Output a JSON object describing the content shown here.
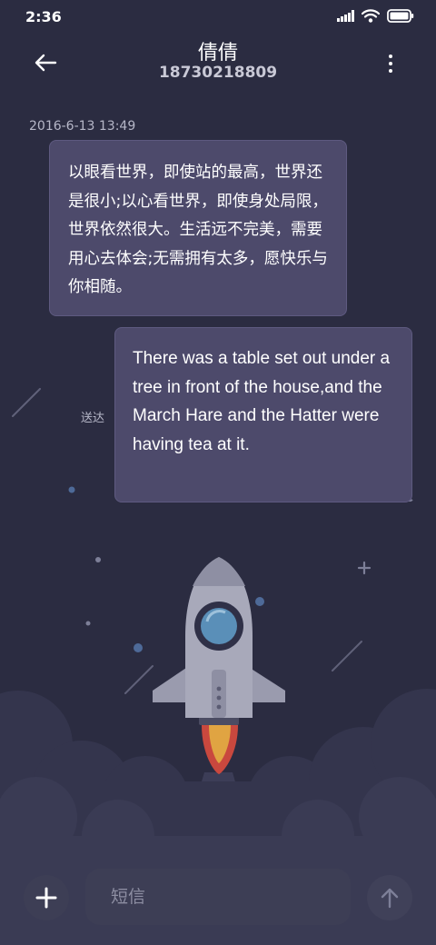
{
  "status_bar": {
    "time": "2:36",
    "icons": [
      "signal-icon",
      "wifi-icon",
      "battery-icon"
    ]
  },
  "header": {
    "back_icon": "back-arrow-icon",
    "contact_name": "倩倩",
    "contact_number": "18730218809",
    "more_icon": "more-vertical-icon"
  },
  "messages": [
    {
      "timestamp": "2016-6-13 13:49",
      "direction": "incoming",
      "text": "以眼看世界，即使站的最高，世界还是很小;以心看世界，即使身处局限，世界依然很大。生活远不完美，需要用心去体会;无需拥有太多，愿快乐与你相随。"
    },
    {
      "direction": "outgoing",
      "status": "送达",
      "text": "There was a table set out under a tree in front of the house,and the March Hare and the Hatter were having tea at it."
    }
  ],
  "input_bar": {
    "add_icon": "plus-icon",
    "placeholder": "短信",
    "send_icon": "arrow-up-icon"
  },
  "colors": {
    "background": "#2b2c41",
    "bubble": "#4d4a6b",
    "secondary_text": "#b6b7c8"
  }
}
